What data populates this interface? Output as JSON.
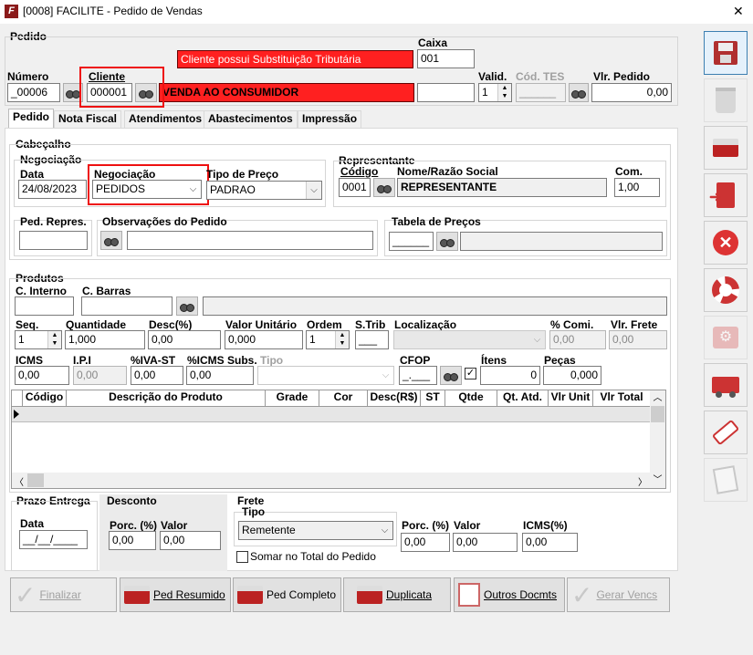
{
  "window": {
    "title": "[0008] FACILITE - Pedido de Vendas",
    "close": "✕"
  },
  "pedido": {
    "group_label": "Pedido",
    "alert": "Cliente possui Substituição Tributária",
    "caixa_label": "Caixa",
    "caixa_value": "001",
    "numero_label": "Número",
    "numero_value": "_00006",
    "cliente_label": "Cliente",
    "cliente_value": "000001",
    "cliente_name": "VENDA AO CONSUMIDOR",
    "valid_label": "Valid.",
    "valid_value": "1",
    "cod_tes_label": "Cód. TES",
    "cod_tes_value": "______",
    "vlr_pedido_label": "Vlr. Pedido",
    "vlr_pedido_value": "0,00"
  },
  "tabs": [
    "Pedido",
    "Nota Fiscal",
    "Atendimentos",
    "Abastecimentos",
    "Impressão"
  ],
  "cabecalho": {
    "label": "Cabeçalho",
    "negociacao_group": "Negociação",
    "data_label": "Data",
    "data_value": "24/08/2023",
    "negociacao_label": "Negociação",
    "negociacao_value": "PEDIDOS",
    "tipo_preco_label": "Tipo de Preço",
    "tipo_preco_value": "PADRAO",
    "representante_group": "Representante",
    "codigo_label": "Código",
    "codigo_value": "0001",
    "nome_label": "Nome/Razão Social",
    "nome_value": "REPRESENTANTE",
    "com_label": "Com.",
    "com_value": "1,00",
    "ped_repres_label": "Ped. Repres.",
    "obs_label": "Observações do Pedido",
    "tabela_label": "Tabela de Preços",
    "tabela_value": "______"
  },
  "produtos": {
    "label": "Produtos",
    "c_interno_label": "C. Interno",
    "c_barras_label": "C. Barras",
    "seq_label": "Seq.",
    "seq_value": "1",
    "quantidade_label": "Quantidade",
    "quantidade_value": "1,000",
    "desc_label": "Desc(%)",
    "desc_value": "0,00",
    "valor_unitario_label": "Valor Unitário",
    "valor_unitario_value": "0,000",
    "ordem_label": "Ordem",
    "ordem_value": "1",
    "strib_label": "S.Trib",
    "strib_value": "___",
    "localizacao_label": "Localização",
    "comi_label": "% Comi.",
    "comi_value": "0,00",
    "vlr_frete_label": "Vlr. Frete",
    "vlr_frete_value": "0,00",
    "icms_label": "ICMS",
    "icms_value": "0,00",
    "ipi_label": "I.P.I",
    "ipi_value": "0,00",
    "iva_label": "%IVA-ST",
    "iva_value": "0,00",
    "icms_subs_label": "%ICMS Subs.",
    "icms_subs_value": "0,00",
    "tipo_label": "Tipo",
    "cfop_label": "CFOP",
    "cfop_value": "_.___",
    "itens_label": "Ítens",
    "itens_value": "0",
    "pecas_label": "Peças",
    "pecas_value": "0,000"
  },
  "grid": {
    "columns": [
      "Código",
      "Descrição do Produto",
      "Grade",
      "Cor",
      "Desc(R$)",
      "ST",
      "Qtde",
      "Qt. Atd.",
      "Vlr Unit",
      "Vlr Total"
    ]
  },
  "prazo": {
    "label": "Prazo Entrega",
    "data_label": "Data",
    "data_value": "__/__/____"
  },
  "desconto": {
    "label": "Desconto",
    "porc_label": "Porc. (%)",
    "porc_value": "0,00",
    "valor_label": "Valor",
    "valor_value": "0,00"
  },
  "frete": {
    "label": "Frete",
    "tipo_label": "Tipo",
    "tipo_value": "Remetente",
    "porc_label": "Porc. (%)",
    "porc_value": "0,00",
    "valor_label": "Valor",
    "valor_value": "0,00",
    "icms_label": "ICMS(%)",
    "icms_value": "0,00",
    "somar_label": "Somar no Total do Pedido"
  },
  "buttons": {
    "finalizar": "Finalizar",
    "ped_resumido": "Ped Resumido",
    "ped_completo": "Ped Completo",
    "duplicata": "Duplicata",
    "outros": "Outros Docmts",
    "gerar": "Gerar Vencs"
  },
  "colors": {
    "alert_red": "#ff2020",
    "highlight": "#e11111"
  }
}
